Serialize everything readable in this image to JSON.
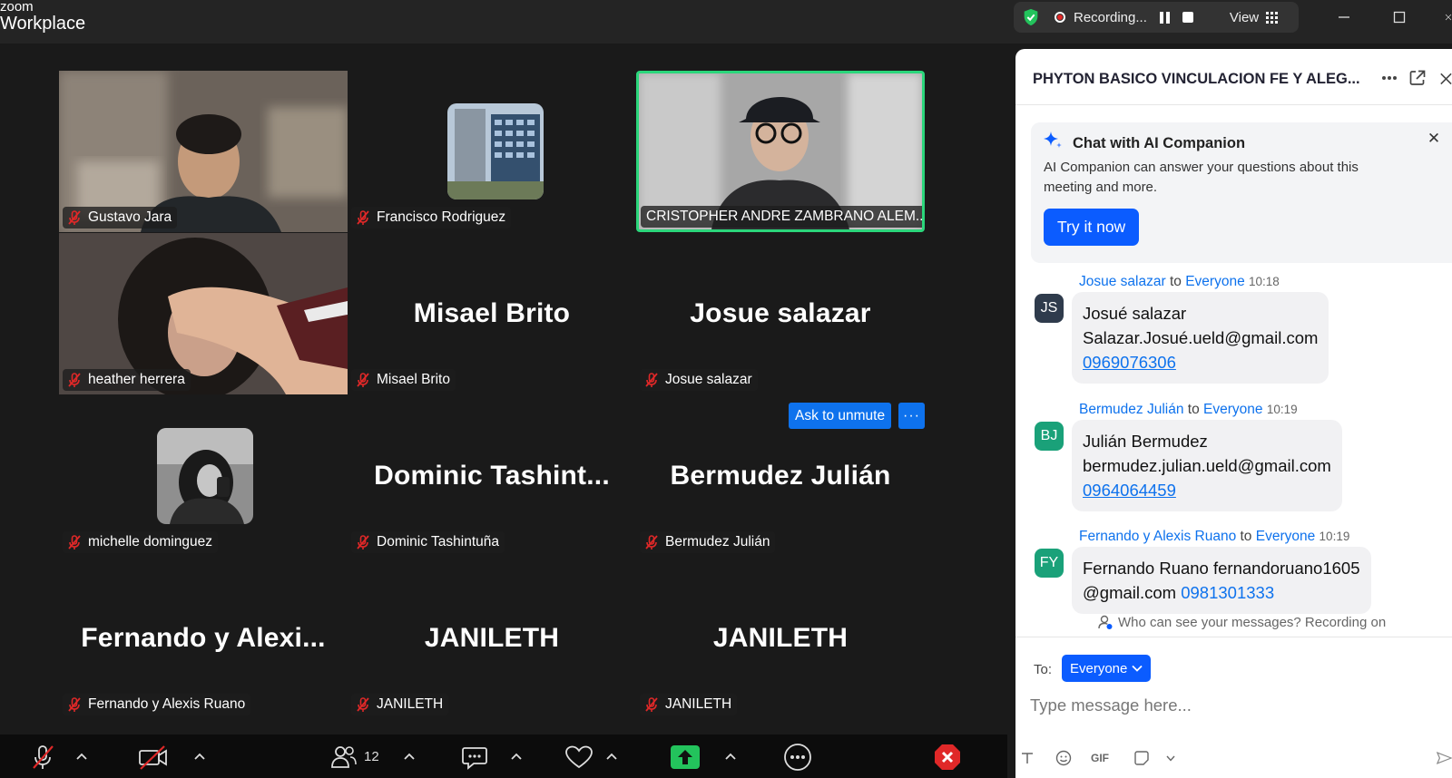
{
  "app": {
    "brand_top": "zoom",
    "brand_bottom": "Workplace"
  },
  "titlebar": {
    "recording_label": "Recording...",
    "view_label": "View"
  },
  "participants": [
    {
      "label": "Gustavo Jara",
      "mode": "video"
    },
    {
      "label": "Francisco Rodriguez",
      "mode": "avatar"
    },
    {
      "label": "CRISTOPHER ANDRE ZAMBRANO ALEM...",
      "mode": "video",
      "active_speaker": true
    },
    {
      "label": "heather herrera",
      "mode": "video"
    },
    {
      "label": "Misael Brito",
      "big": "Misael Brito",
      "mode": "name"
    },
    {
      "label": "Josue salazar",
      "big": "Josue salazar",
      "mode": "name"
    },
    {
      "label": "michelle dominguez",
      "mode": "avatar"
    },
    {
      "label": "Dominic Tashintuña",
      "big": "Dominic  Tashint...",
      "mode": "name"
    },
    {
      "label": "Bermudez Julián",
      "big": "Bermudez Julián",
      "mode": "name"
    },
    {
      "label": "Fernando y Alexis Ruano",
      "big": "Fernando  y  Alexi...",
      "mode": "name"
    },
    {
      "label": "JANILETH",
      "big": "JANILETH",
      "mode": "name"
    },
    {
      "label": "JANILETH",
      "big": "JANILETH",
      "mode": "name"
    }
  ],
  "hover_actions": {
    "ask_unmute": "Ask to unmute",
    "more": "···"
  },
  "toolbar": {
    "participants_count": "12"
  },
  "chat": {
    "title": "PHYTON BASICO VINCULACION FE Y ALEG...",
    "ai": {
      "title": "Chat with AI Companion",
      "description": "AI Companion can answer your questions about this meeting and more.",
      "button": "Try it now"
    },
    "to_word": "to",
    "messages": [
      {
        "sender": "Josue salazar",
        "recipient": "Everyone",
        "time": "10:18",
        "initials": "JS",
        "avatar_color": "#2f3b4c",
        "line1": "Josué salazar",
        "line2": "Salazar.Josué.ueld@gmail.com",
        "phone": "0969076306"
      },
      {
        "sender": "Bermudez Julián",
        "recipient": "Everyone",
        "time": "10:19",
        "initials": "BJ",
        "avatar_color": "#1aa179",
        "line1": "Julián Bermudez",
        "line2": "bermudez.julian.ueld@gmail.com",
        "phone": "0964064459"
      },
      {
        "sender": "Fernando y Alexis Ruano",
        "recipient": "Everyone",
        "time": "10:19",
        "initials": "FY",
        "avatar_color": "#1aa179",
        "line1": "Fernando Ruano fernandoruano1605",
        "line2a": "@gmail.com",
        "phone": "0981301333"
      }
    ],
    "privacy_note": "Who can see your messages? Recording on",
    "to_label": "To:",
    "to_value": "Everyone",
    "input_placeholder": "Type message here...",
    "format_gif": "GIF"
  },
  "colors": {
    "accent": "#0e72ed",
    "speaker_border": "#2bd67b",
    "mute_red": "#e02828",
    "leave_red": "#e02828",
    "share_green": "#23c35c"
  }
}
